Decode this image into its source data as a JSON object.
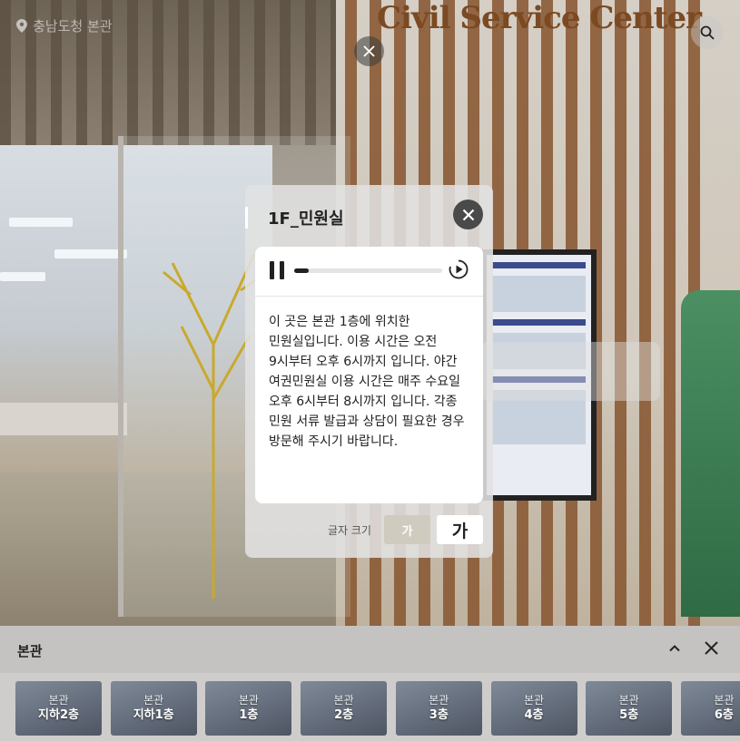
{
  "location": {
    "label": "충남도청 본관"
  },
  "scene": {
    "sign_text": "Civil Service Center"
  },
  "modal": {
    "title": "1F_민원실",
    "audio_progress": 0.1,
    "description": "이 곳은 본관 1층에 위치한\n민원실입니다. 이용 시간은 오전\n9시부터 오후 6시까지 입니다. 야간\n여권민원실 이용 시간은 매주 수요일\n오후 6시부터 8시까지 입니다. 각종\n민원 서류 발급과 상담이 필요한 경우\n방문해 주시기 바랍니다.",
    "font_size_label": "글자 크기",
    "font_small": "가",
    "font_large": "가"
  },
  "floor_bar": {
    "title": "본관",
    "floors": [
      {
        "building": "본관",
        "floor": "지하2층"
      },
      {
        "building": "본관",
        "floor": "지하1층"
      },
      {
        "building": "본관",
        "floor": "1층"
      },
      {
        "building": "본관",
        "floor": "2층"
      },
      {
        "building": "본관",
        "floor": "3층"
      },
      {
        "building": "본관",
        "floor": "4층"
      },
      {
        "building": "본관",
        "floor": "5층"
      },
      {
        "building": "본관",
        "floor": "6층"
      }
    ]
  },
  "icons": [
    "location-pin-icon",
    "search-icon",
    "close-icon",
    "pause-icon",
    "play-circle-icon",
    "chevron-up-icon"
  ]
}
